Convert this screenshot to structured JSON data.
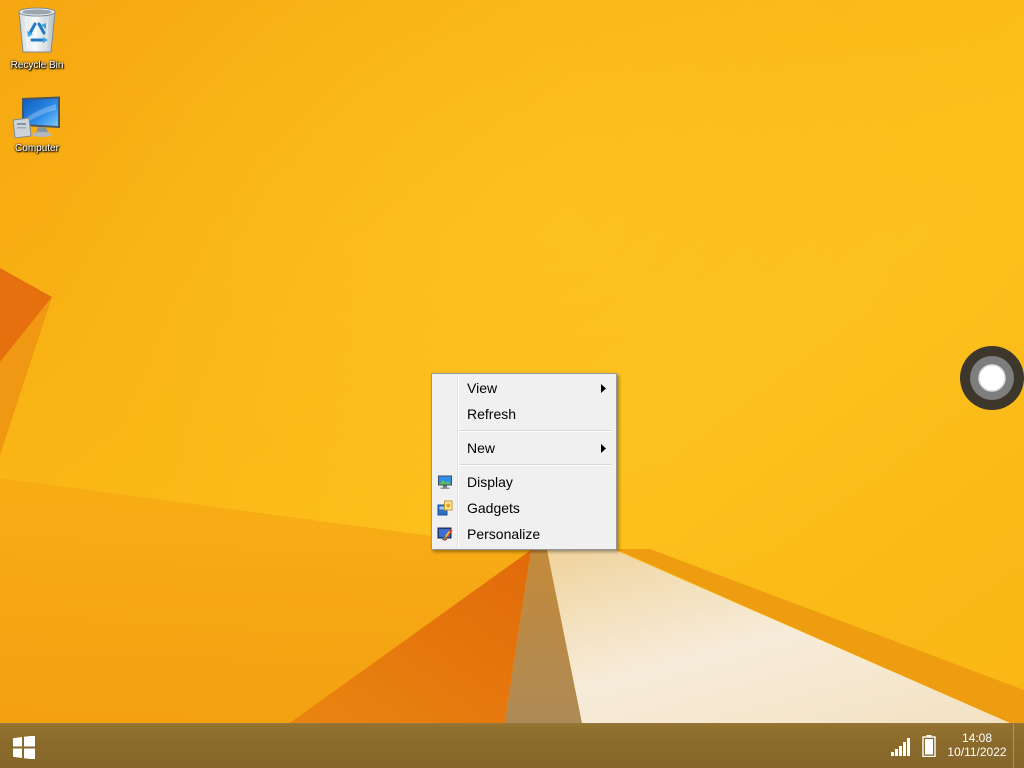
{
  "desktop": {
    "icons": [
      {
        "label": "Recycle Bin",
        "icon": "recycle-bin-icon"
      },
      {
        "label": "Computer",
        "icon": "computer-icon"
      }
    ]
  },
  "context_menu": {
    "items": [
      {
        "label": "View",
        "has_submenu": true
      },
      {
        "label": "Refresh",
        "has_submenu": false
      },
      {
        "label": "New",
        "has_submenu": true
      },
      {
        "label": "Display",
        "has_submenu": false,
        "icon": "display-icon"
      },
      {
        "label": "Gadgets",
        "has_submenu": false,
        "icon": "gadgets-icon"
      },
      {
        "label": "Personalize",
        "has_submenu": false,
        "icon": "personalize-icon"
      }
    ]
  },
  "floating_button": {
    "icon": "assistive-touch-icon"
  },
  "taskbar": {
    "start_icon": "windows-logo-icon",
    "tray_icons": [
      "signal-strength-icon",
      "battery-icon"
    ],
    "battery_level": 1.0,
    "clock": {
      "time": "14:08",
      "date": "10/11/2022"
    }
  },
  "colors": {
    "wallpaper": "#fbbd18",
    "taskbar": "#8b6b2c",
    "menu_background": "#f0f0f0",
    "menu_border": "#979797"
  }
}
